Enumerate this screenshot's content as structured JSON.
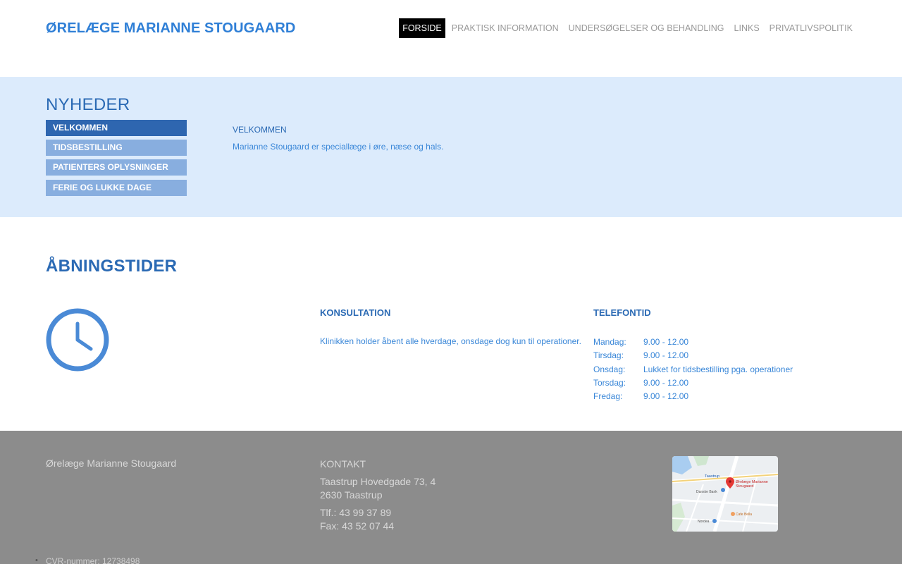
{
  "header": {
    "site_title": "ØRELÆGE MARIANNE STOUGAARD",
    "nav": [
      {
        "label": "FORSIDE",
        "active": true
      },
      {
        "label": "PRAKTISK INFORMATION",
        "active": false
      },
      {
        "label": "UNDERSØGELSER OG BEHANDLING",
        "active": false
      },
      {
        "label": "LINKS",
        "active": false
      },
      {
        "label": "PRIVATLIVSPOLITIK",
        "active": false
      }
    ]
  },
  "news": {
    "heading": "NYHEDER",
    "tabs": [
      {
        "label": "VELKOMMEN",
        "active": true
      },
      {
        "label": "TIDSBESTILLING",
        "active": false
      },
      {
        "label": "PATIENTERS OPLYSNINGER",
        "active": false
      },
      {
        "label": "FERIE OG LUKKE DAGE",
        "active": false
      }
    ],
    "content_title": "VELKOMMEN",
    "content_text": "Marianne Stougaard er speciallæge i øre, næse og hals."
  },
  "hours": {
    "heading": "ÅBNINGSTIDER",
    "clock_icon": "clock-icon",
    "consultation": {
      "title": "KONSULTATION",
      "text": "Klinikken holder åbent alle hverdage, onsdage dog kun til operationer."
    },
    "phone": {
      "title": "TELEFONTID",
      "rows": [
        {
          "day": "Mandag:",
          "time": "9.00 - 12.00"
        },
        {
          "day": "Tirsdag:",
          "time": "9.00 - 12.00"
        },
        {
          "day": "Onsdag:",
          "time": "Lukket for tidsbestilling pga. operationer"
        },
        {
          "day": "Torsdag:",
          "time": "9.00 - 12.00"
        },
        {
          "day": "Fredag:",
          "time": "9.00 - 12.00"
        }
      ]
    }
  },
  "footer": {
    "name": "Ørelæge Marianne Stougaard",
    "contact_title": "KONTAKT",
    "address_line1": "Taastrup Hovedgade 73, 4",
    "address_line2": "2630 Taastrup",
    "phone": "Tlf.: 43 99 37 89",
    "fax": "Fax: 43 52 07 44",
    "cvr": "CVR-nummer: 12738498",
    "map": {
      "pin_label_1": "Ørelæge Marianne",
      "pin_label_2": "Stougaard",
      "labels": [
        "Taastrup",
        "Danske Bank",
        "Cafe Bella",
        "Nordea"
      ]
    }
  },
  "colors": {
    "brand_blue": "#2f7fd6",
    "news_bg": "#dcebfc",
    "tab_active": "#2e66b0",
    "tab_inactive": "#88aedf",
    "footer_bg": "#8c8c8c"
  }
}
